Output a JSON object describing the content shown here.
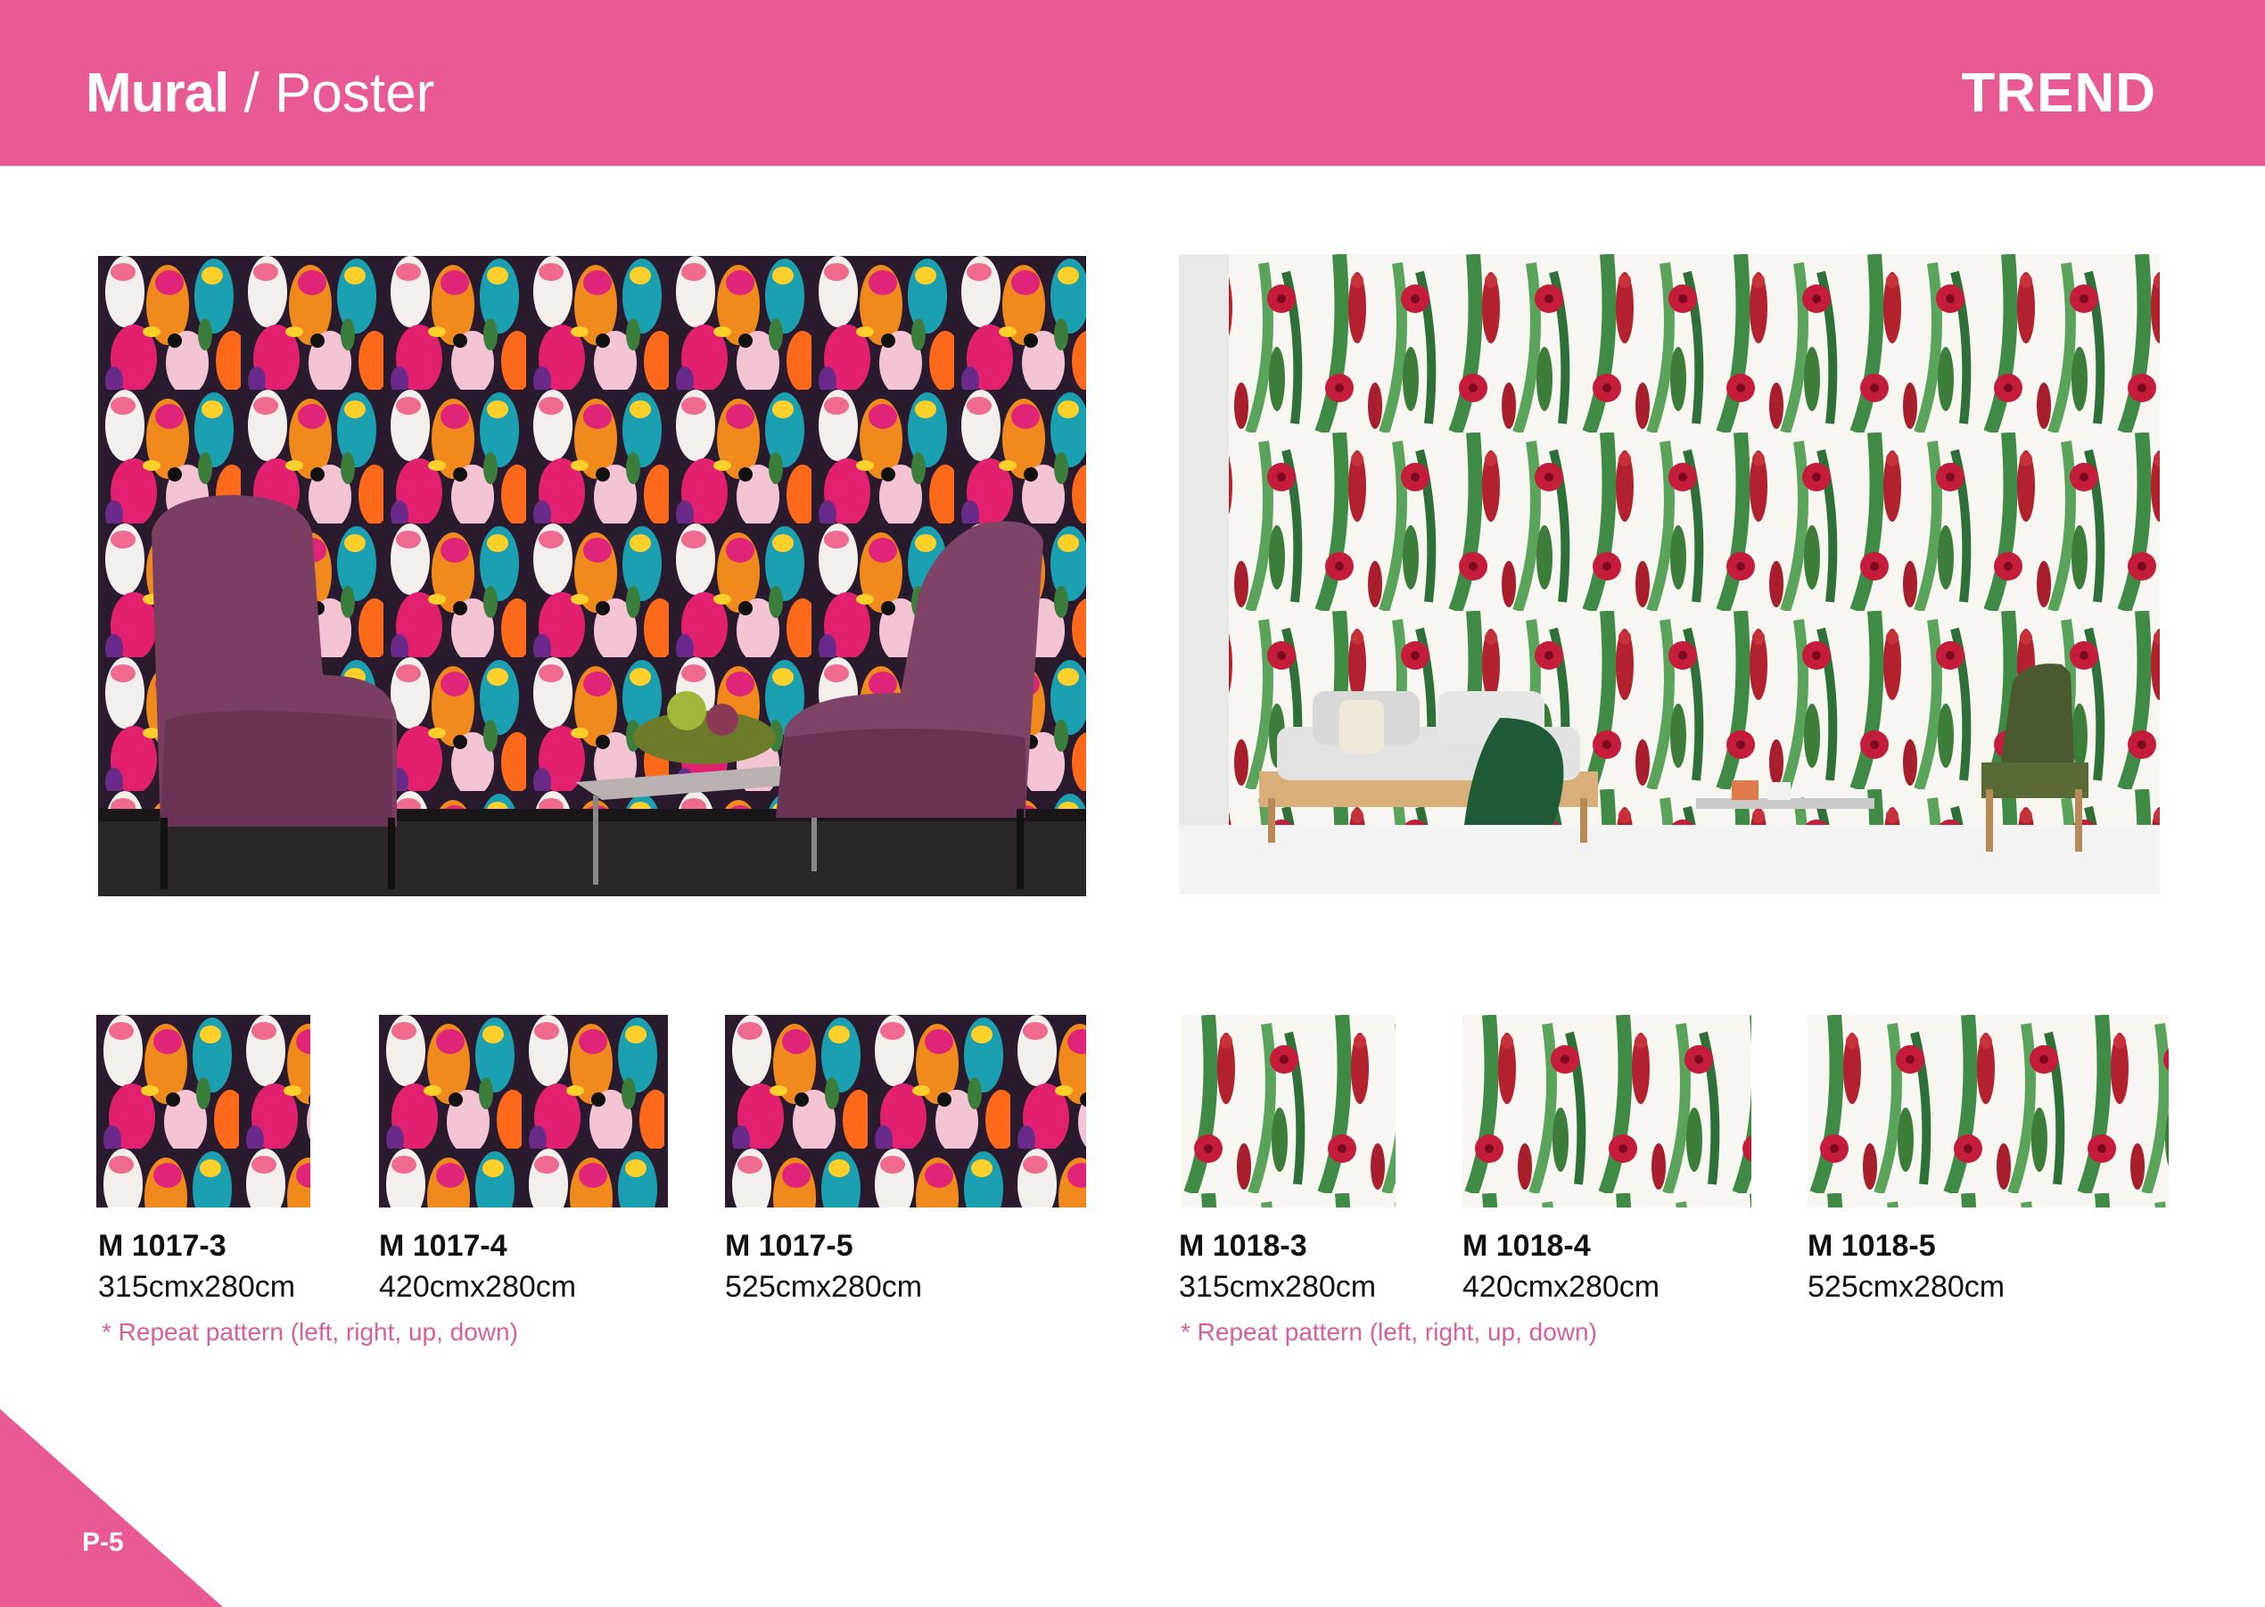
{
  "header": {
    "title_strong": "Mural",
    "title_rest": " / Poster",
    "trend": "TREND",
    "accent": "#e95a94"
  },
  "products": [
    {
      "code": "M 1017-3",
      "size": "315cmx280cm"
    },
    {
      "code": "M 1017-4",
      "size": "420cmx280cm"
    },
    {
      "code": "M 1017-5",
      "size": "525cmx280cm"
    },
    {
      "code": "M 1018-3",
      "size": "315cmx280cm"
    },
    {
      "code": "M 1018-4",
      "size": "420cmx280cm"
    },
    {
      "code": "M 1018-5",
      "size": "525cmx280cm"
    }
  ],
  "notes": {
    "left": "* Repeat pattern (left, right, up, down)",
    "right": "* Repeat pattern (left, right, up, down)"
  },
  "footer": {
    "page": "P-5"
  }
}
